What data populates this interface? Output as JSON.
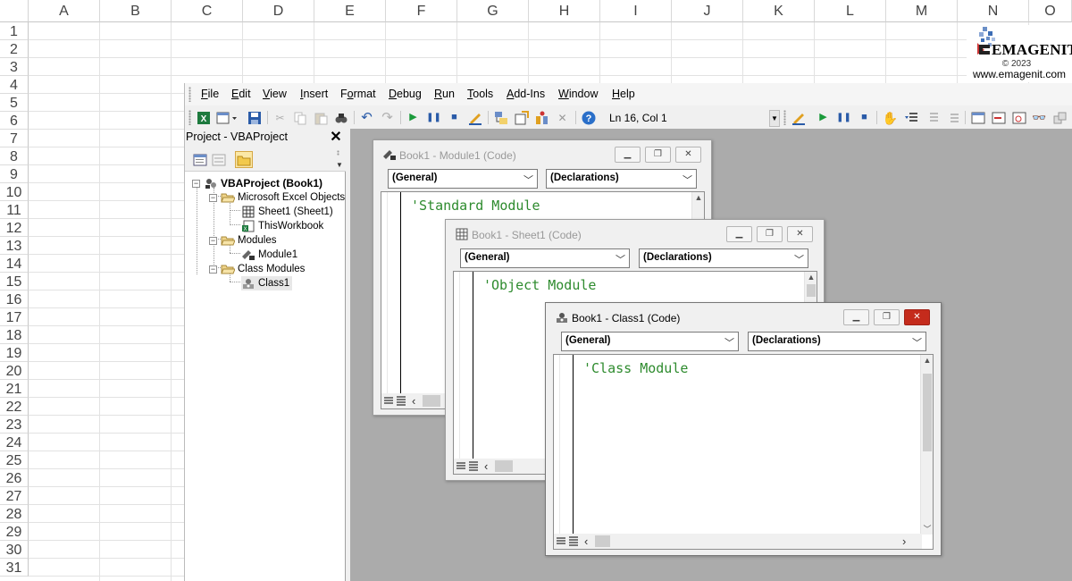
{
  "sheet": {
    "columns": [
      "A",
      "B",
      "C",
      "D",
      "E",
      "F",
      "G",
      "H",
      "I",
      "J",
      "K",
      "L",
      "M",
      "N",
      "O"
    ],
    "rows": [
      "1",
      "2",
      "3",
      "4",
      "5",
      "6",
      "7",
      "8",
      "9",
      "10",
      "11",
      "12",
      "13",
      "14",
      "15",
      "16",
      "17",
      "18",
      "19",
      "20",
      "21",
      "22",
      "23",
      "24",
      "25",
      "26",
      "27",
      "28",
      "29",
      "30",
      "31"
    ]
  },
  "logo": {
    "brand": "EMAGENIT",
    "copyright": "© 2023",
    "url": "www.emagenit.com"
  },
  "menu": [
    {
      "first": "F",
      "rest": "ile"
    },
    {
      "first": "E",
      "rest": "dit"
    },
    {
      "first": "V",
      "rest": "iew"
    },
    {
      "first": "I",
      "rest": "nsert"
    },
    {
      "first": "",
      "rest": "Format",
      "u_index": 1
    },
    {
      "first": "D",
      "rest": "ebug"
    },
    {
      "first": "R",
      "rest": "un"
    },
    {
      "first": "T",
      "rest": "ools"
    },
    {
      "first": "A",
      "rest": "dd-Ins"
    },
    {
      "first": "W",
      "rest": "indow"
    },
    {
      "first": "H",
      "rest": "elp"
    }
  ],
  "toolbar": {
    "position": "Ln 16, Col 1"
  },
  "project": {
    "title": "Project - VBAProject",
    "close": "✕",
    "tree": [
      {
        "label": "VBAProject (Book1)",
        "level": 0,
        "bold": true,
        "icon": "vba-project-icon",
        "expander": "−"
      },
      {
        "label": "Microsoft Excel Objects",
        "level": 1,
        "icon": "folder-open-icon",
        "expander": "−"
      },
      {
        "label": "Sheet1 (Sheet1)",
        "level": 2,
        "icon": "worksheet-icon"
      },
      {
        "label": "ThisWorkbook",
        "level": 2,
        "icon": "workbook-icon"
      },
      {
        "label": "Modules",
        "level": 1,
        "icon": "folder-open-icon",
        "expander": "−"
      },
      {
        "label": "Module1",
        "level": 2,
        "icon": "module-icon"
      },
      {
        "label": "Class Modules",
        "level": 1,
        "icon": "folder-open-icon",
        "expander": "−"
      },
      {
        "label": "Class1",
        "level": 2,
        "icon": "class-module-icon"
      }
    ]
  },
  "windows": {
    "module": {
      "title": "Book1 - Module1 (Code)",
      "object": "(General)",
      "procedure": "(Declarations)",
      "code": "'Standard Module"
    },
    "sheet": {
      "title": "Book1 - Sheet1 (Code)",
      "object": "(General)",
      "procedure": "(Declarations)",
      "code": "'Object Module"
    },
    "class": {
      "title": "Book1 - Class1 (Code)",
      "object": "(General)",
      "procedure": "(Declarations)",
      "code": "'Class Module"
    }
  },
  "colors": {
    "comment": "#2e8b2e",
    "close_active": "#c42b1c",
    "mdi_background": "#ababab"
  }
}
